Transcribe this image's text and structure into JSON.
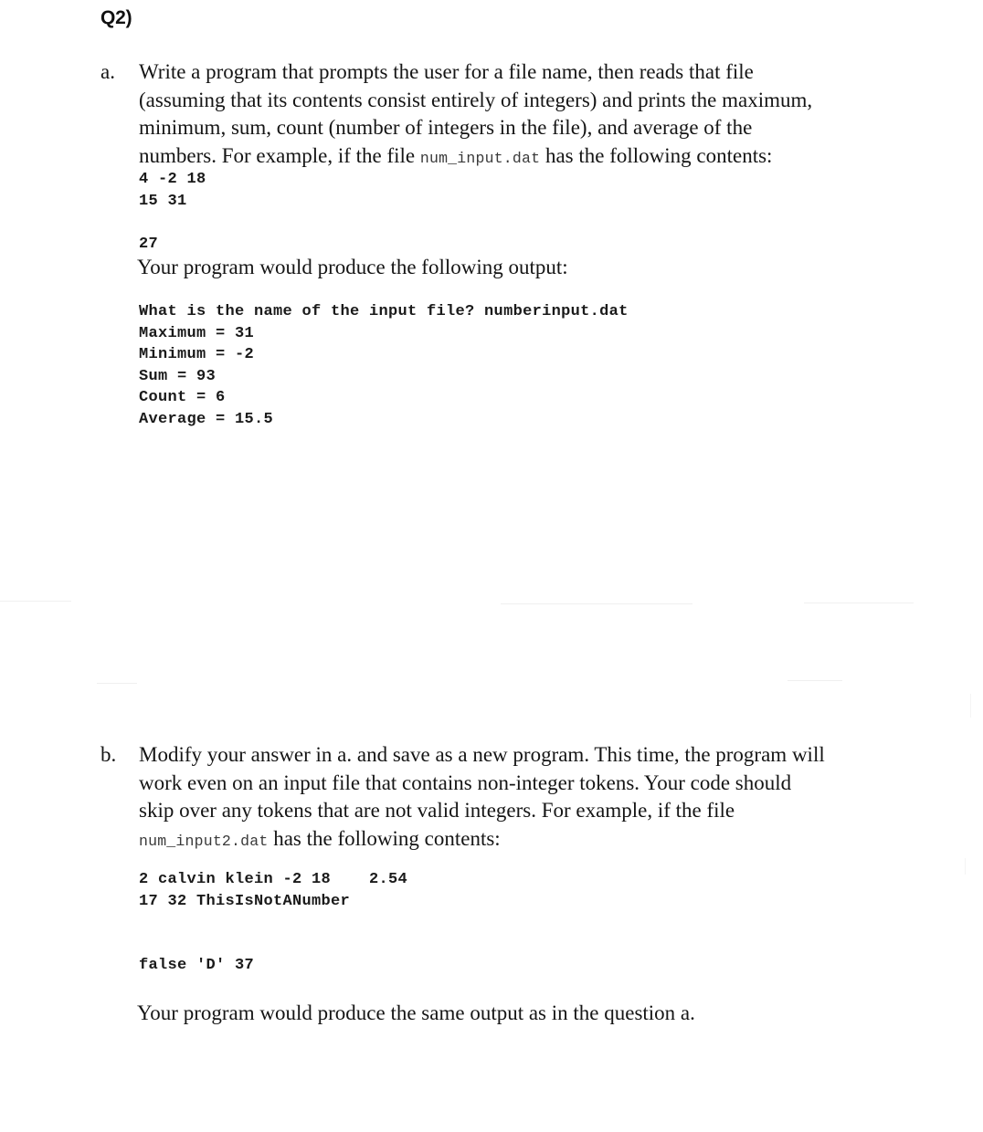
{
  "document": {
    "heading": "Q2)",
    "items": [
      {
        "marker": "a.",
        "paragraph_lines": [
          "Write a program that prompts the user for a file name, then reads that file",
          "(assuming that its contents consist entirely of integers) and prints the maximum,",
          "minimum, sum, count (number of integers in the file), and average of the",
          "numbers. For example, if the file "
        ],
        "inline_code": "num_input.dat",
        "paragraph_tail": " has the following contents:",
        "file_contents": "4 -2 18\n15 31\n\n27",
        "output_intro": "Your program would produce the following output:",
        "program_output": "What is the name of the input file? numberinput.dat\nMaximum = 31\nMinimum = -2\nSum = 93\nCount = 6\nAverage = 15.5"
      },
      {
        "marker": "b.",
        "paragraph_lines": [
          "Modify your answer in a. and save as a new program. This time, the program will",
          "work even on an input file that contains non-integer tokens. Your code should",
          "skip over any tokens that are not valid integers. For example, if the file",
          ""
        ],
        "inline_code": "num_input2.dat",
        "paragraph_tail": " has the following contents:",
        "file_contents": "2 calvin klein -2 18    2.54\n17 32 ThisIsNotANumber\n\n\nfalse 'D' 37",
        "closing_line": "Your program would produce the same output as in the question a."
      }
    ]
  }
}
